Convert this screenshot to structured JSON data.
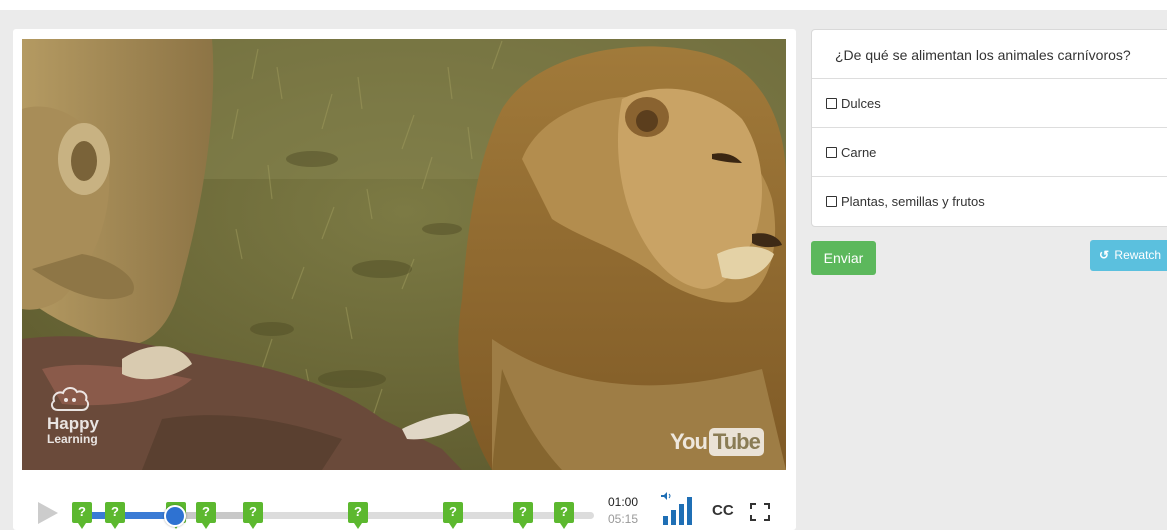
{
  "player": {
    "watermark_left_line1": "Happy",
    "watermark_left_line2": "Learning",
    "watermark_right_you": "You",
    "watermark_right_tube": "Tube",
    "marker_label": "?",
    "current_time": "01:00",
    "total_time": "05:15",
    "cc_label": "CC",
    "progress_fraction": 0.19,
    "buffered_fraction": 0.34,
    "marker_count": 10,
    "accent_color": "#3a7bd5",
    "marker_color": "#5cb82f"
  },
  "quiz": {
    "question": "¿De qué se alimentan los animales carnívoros?",
    "options": [
      {
        "label": "Dulces"
      },
      {
        "label": "Carne"
      },
      {
        "label": "Plantas, semillas y frutos"
      }
    ],
    "submit_label": "Enviar",
    "rewatch_icon": "↺",
    "rewatch_label": "Rewatch",
    "submit_color": "#5cb85c",
    "rewatch_color": "#5bc0de"
  }
}
